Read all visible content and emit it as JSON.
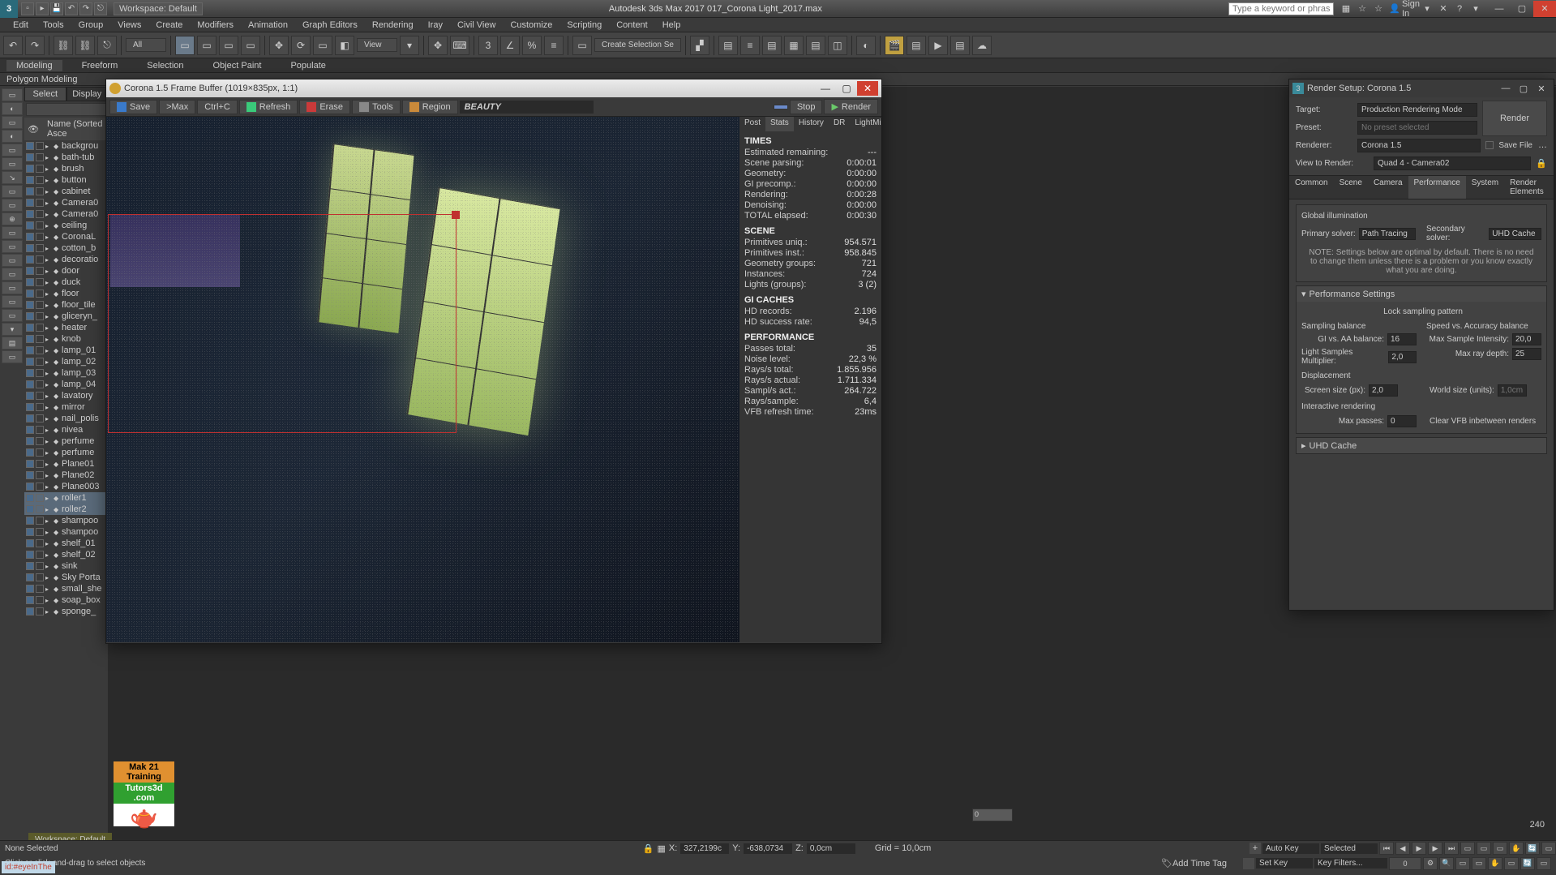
{
  "titlebar": {
    "workspace_dd": "Workspace: Default",
    "title": "Autodesk 3ds Max 2017    017_Corona Light_2017.max",
    "search_placeholder": "Type a keyword or phrase",
    "signin": "Sign In"
  },
  "menubar": [
    "Edit",
    "Tools",
    "Group",
    "Views",
    "Create",
    "Modifiers",
    "Animation",
    "Graph Editors",
    "Rendering",
    "Iray",
    "Civil View",
    "Customize",
    "Scripting",
    "Content",
    "Help"
  ],
  "ribbon": {
    "tabs": [
      "Modeling",
      "Freeform",
      "Selection",
      "Object Paint",
      "Populate"
    ],
    "active": 0,
    "sub": "Polygon Modeling"
  },
  "toolbar": {
    "all_dd": "All",
    "view_dd": "View",
    "create_sel_dd": "Create Selection Se"
  },
  "scene": {
    "tabs": [
      "Select",
      "Display"
    ],
    "header": "Name (Sorted Asce",
    "items": [
      {
        "name": "backgrou"
      },
      {
        "name": "bath-tub"
      },
      {
        "name": "brush"
      },
      {
        "name": "button"
      },
      {
        "name": "cabinet"
      },
      {
        "name": "Camera0"
      },
      {
        "name": "Camera0"
      },
      {
        "name": "ceiling"
      },
      {
        "name": "CoronaL"
      },
      {
        "name": "cotton_b"
      },
      {
        "name": "decoratio"
      },
      {
        "name": "door"
      },
      {
        "name": "duck"
      },
      {
        "name": "floor"
      },
      {
        "name": "floor_tile"
      },
      {
        "name": "gliceryn_"
      },
      {
        "name": "heater"
      },
      {
        "name": "knob"
      },
      {
        "name": "lamp_01"
      },
      {
        "name": "lamp_02"
      },
      {
        "name": "lamp_03"
      },
      {
        "name": "lamp_04"
      },
      {
        "name": "lavatory"
      },
      {
        "name": "mirror"
      },
      {
        "name": "nail_polis"
      },
      {
        "name": "nivea"
      },
      {
        "name": "perfume"
      },
      {
        "name": "perfume"
      },
      {
        "name": "Plane01"
      },
      {
        "name": "Plane02"
      },
      {
        "name": "Plane003"
      },
      {
        "name": "roller1",
        "sel": true
      },
      {
        "name": "roller2",
        "sel": true
      },
      {
        "name": "shampoo"
      },
      {
        "name": "shampoo"
      },
      {
        "name": "shelf_01"
      },
      {
        "name": "shelf_02"
      },
      {
        "name": "sink"
      },
      {
        "name": "Sky Porta"
      },
      {
        "name": "small_she"
      },
      {
        "name": "soap_box"
      },
      {
        "name": "sponge_"
      }
    ]
  },
  "fb": {
    "title": "Corona 1.5 Frame Buffer (1019×835px, 1:1)",
    "toolbar": {
      "save": "Save",
      "maxpass": ">Max",
      "ctrlc": "Ctrl+C",
      "refresh": "Refresh",
      "erase": "Erase",
      "tools": "Tools",
      "region": "Region",
      "channel": "BEAUTY",
      "stop": "Stop",
      "render": "Render"
    },
    "tabs": [
      "Post",
      "Stats",
      "History",
      "DR",
      "LightMix"
    ],
    "stats": {
      "times_h": "TIMES",
      "times": [
        {
          "k": "Estimated remaining:",
          "v": "---"
        },
        {
          "k": "Scene parsing:",
          "v": "0:00:01"
        },
        {
          "k": "Geometry:",
          "v": "0:00:00"
        },
        {
          "k": "GI precomp.:",
          "v": "0:00:00"
        },
        {
          "k": "Rendering:",
          "v": "0:00:28"
        },
        {
          "k": "Denoising:",
          "v": "0:00:00"
        },
        {
          "k": "TOTAL elapsed:",
          "v": "0:00:30"
        }
      ],
      "scene_h": "SCENE",
      "scene": [
        {
          "k": "Primitives uniq.:",
          "v": "954.571"
        },
        {
          "k": "Primitives inst.:",
          "v": "958.845"
        },
        {
          "k": "Geometry groups:",
          "v": "721"
        },
        {
          "k": "Instances:",
          "v": "724"
        },
        {
          "k": "Lights (groups):",
          "v": "3 (2)"
        }
      ],
      "gi_h": "GI CACHES",
      "gi": [
        {
          "k": "HD records:",
          "v": "2.196"
        },
        {
          "k": "HD success rate:",
          "v": "94,5"
        }
      ],
      "perf_h": "PERFORMANCE",
      "perf": [
        {
          "k": "Passes total:",
          "v": "35"
        },
        {
          "k": "Noise level:",
          "v": "22,3 %"
        },
        {
          "k": "Rays/s total:",
          "v": "1.855.956"
        },
        {
          "k": "Rays/s actual:",
          "v": "1.711.334"
        },
        {
          "k": "Sampl/s act.:",
          "v": "264.722"
        },
        {
          "k": "Rays/sample:",
          "v": "6,4"
        },
        {
          "k": "VFB refresh time:",
          "v": "23ms"
        }
      ]
    }
  },
  "rs": {
    "title": "Render Setup: Corona 1.5",
    "target_l": "Target:",
    "target_v": "Production Rendering Mode",
    "preset_l": "Preset:",
    "preset_v": "No preset selected",
    "renderer_l": "Renderer:",
    "renderer_v": "Corona 1.5",
    "savefile": "Save File",
    "view_l": "View to Render:",
    "view_v": "Quad 4 - Camera02",
    "render_btn": "Render",
    "tabs": [
      "Common",
      "Scene",
      "Camera",
      "Performance",
      "System",
      "Render Elements"
    ],
    "gi_h": "Global illumination",
    "primary_l": "Primary solver:",
    "primary_v": "Path Tracing",
    "secondary_l": "Secondary solver:",
    "secondary_v": "UHD Cache",
    "note": "NOTE: Settings below are optimal by default. There is no need to change them unless there is a problem or you know exactly what you are doing.",
    "perf_h": "Performance Settings",
    "lock": "Lock sampling pattern",
    "samp_h": "Sampling balance",
    "speed_h": "Speed vs. Accuracy balance",
    "gi_aa_l": "GI vs. AA balance:",
    "gi_aa_v": "16",
    "max_int_l": "Max Sample Intensity:",
    "max_int_v": "20,0",
    "light_mul_l": "Light Samples Multiplier:",
    "light_mul_v": "2,0",
    "max_ray_l": "Max ray depth:",
    "max_ray_v": "25",
    "disp_h": "Displacement",
    "screen_l": "Screen size (px):",
    "screen_v": "2,0",
    "world_l": "World size (units):",
    "world_v": "1,0cm",
    "inter_h": "Interactive rendering",
    "maxpass_l": "Max passes:",
    "maxpass_v": "0",
    "clear_vfb": "Clear VFB inbetween renders",
    "uhd_h": "UHD Cache"
  },
  "status": {
    "sel": "None Selected",
    "hint": "Click or click-and-drag to select objects",
    "x_l": "X:",
    "x_v": "327,2199c",
    "y_l": "Y:",
    "y_v": "-638,0734",
    "z_l": "Z:",
    "z_v": "0,0cm",
    "grid": "Grid = 10,0cm",
    "addtag": "Add Time Tag",
    "autokey": "Auto Key",
    "setkey": "Set Key",
    "sel_dd": "Selected",
    "keyf": "Key Filters...",
    "frame": "0",
    "timeline_end": "240"
  },
  "training": {
    "l1": "Mak 21 Training",
    "l2": "Tutors3d .com"
  },
  "idbox": "id:#eyeInThe",
  "ws_label": "Workspace: Default"
}
